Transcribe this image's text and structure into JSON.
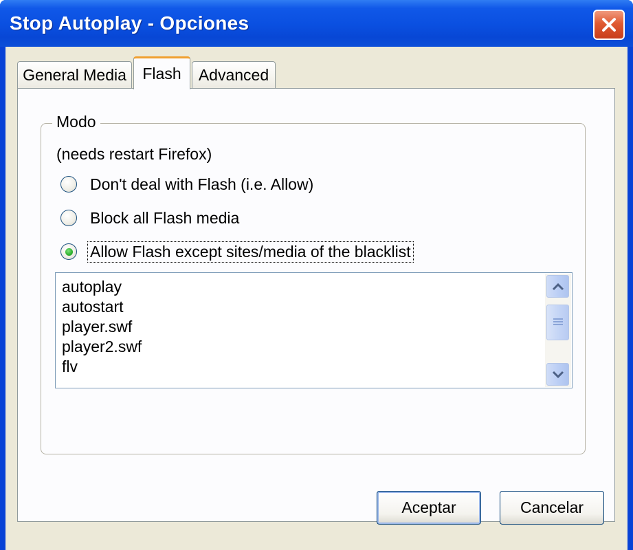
{
  "window": {
    "title": "Stop Autoplay - Opciones"
  },
  "tabs": [
    {
      "label": "General Media",
      "active": false
    },
    {
      "label": "Flash",
      "active": true
    },
    {
      "label": "Advanced",
      "active": false
    }
  ],
  "group": {
    "legend": "Modo",
    "note": "(needs restart Firefox)",
    "options": [
      {
        "label": "Don't deal with Flash (i.e. Allow)",
        "checked": false
      },
      {
        "label": "Block all Flash media",
        "checked": false
      },
      {
        "label": "Allow Flash except sites/media of the blacklist",
        "checked": true
      }
    ]
  },
  "blacklist": {
    "items": [
      "autoplay",
      "autostart",
      "player.swf",
      "player2.swf",
      "flv"
    ]
  },
  "buttons": {
    "accept": "Aceptar",
    "cancel": "Cancelar"
  },
  "colors": {
    "title_bar": "#0a4fe0",
    "dialog_face": "#ece9d8",
    "tab_accent": "#f0a030",
    "close_button": "#e05a32",
    "radio_selected": "#2fb12f"
  }
}
